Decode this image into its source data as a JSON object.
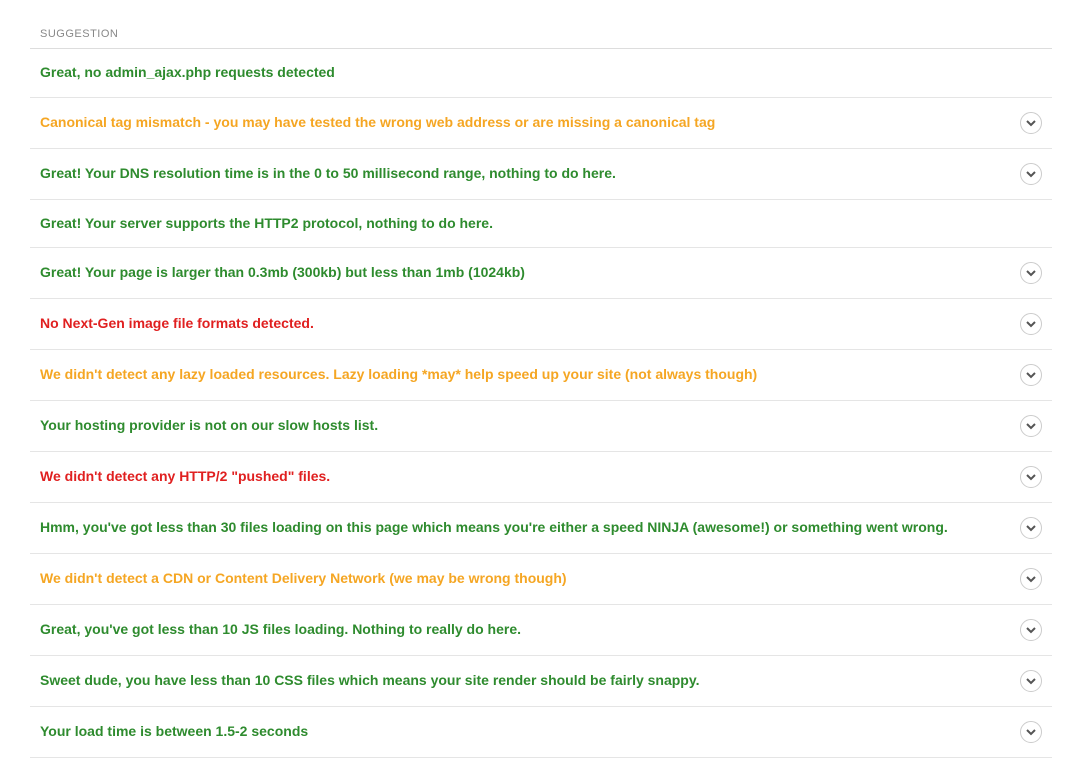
{
  "header": {
    "title": "SUGGESTION"
  },
  "suggestions": [
    {
      "text": "Great, no admin_ajax.php requests detected",
      "status": "good",
      "expandable": false
    },
    {
      "text": "Canonical tag mismatch - you may have tested the wrong web address or are missing a canonical tag",
      "status": "warn",
      "expandable": true
    },
    {
      "text": "Great! Your DNS resolution time is in the 0 to 50 millisecond range, nothing to do here.",
      "status": "good",
      "expandable": true
    },
    {
      "text": "Great! Your server supports the HTTP2 protocol, nothing to do here.",
      "status": "good",
      "expandable": false
    },
    {
      "text": "Great! Your page is larger than 0.3mb (300kb) but less than 1mb (1024kb)",
      "status": "good",
      "expandable": true
    },
    {
      "text": "No Next-Gen image file formats detected.",
      "status": "bad",
      "expandable": true
    },
    {
      "text": "We didn't detect any lazy loaded resources. Lazy loading *may* help speed up your site (not always though)",
      "status": "warn",
      "expandable": true
    },
    {
      "text": "Your hosting provider is not on our slow hosts list.",
      "status": "good",
      "expandable": true
    },
    {
      "text": "We didn't detect any HTTP/2 \"pushed\" files.",
      "status": "bad",
      "expandable": true
    },
    {
      "text": "Hmm, you've got less than 30 files loading on this page which means you're either a speed NINJA (awesome!) or something went wrong.",
      "status": "good",
      "expandable": true
    },
    {
      "text": "We didn't detect a CDN or Content Delivery Network (we may be wrong though)",
      "status": "warn",
      "expandable": true
    },
    {
      "text": "Great, you've got less than 10 JS files loading. Nothing to really do here.",
      "status": "good",
      "expandable": true
    },
    {
      "text": "Sweet dude, you have less than 10 CSS files which means your site render should be fairly snappy.",
      "status": "good",
      "expandable": true
    },
    {
      "text": "Your load time is between 1.5-2 seconds",
      "status": "good",
      "expandable": true
    }
  ],
  "colors": {
    "good": "#2e8b2e",
    "warn": "#f5a623",
    "bad": "#e02020"
  }
}
